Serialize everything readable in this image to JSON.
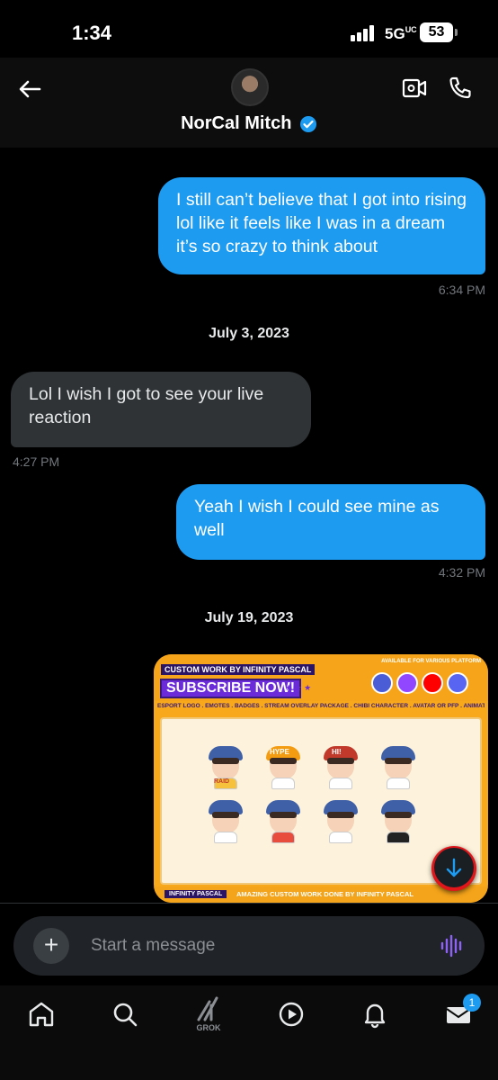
{
  "status_bar": {
    "time": "1:34",
    "network": "5G",
    "network_suffix": "UC",
    "battery": "53"
  },
  "header": {
    "contact_name": "NorCal Mitch",
    "verified": true,
    "icons": [
      "back-arrow-icon",
      "video-call-icon",
      "phone-call-icon",
      "verified-badge-icon"
    ]
  },
  "messages": [
    {
      "type": "out",
      "text": "I still can’t believe that I got into rising lol like it feels like I was in a dream it’s so crazy to think about",
      "time": "6:34 PM"
    },
    {
      "type": "date",
      "text": "July 3, 2023"
    },
    {
      "type": "in",
      "text": "Lol I wish I got to see your live reaction",
      "time": "4:27 PM"
    },
    {
      "type": "out",
      "text": "Yeah I wish I could see mine as well",
      "time": "4:32 PM"
    },
    {
      "type": "date",
      "text": "July 19, 2023"
    }
  ],
  "image_attachment": {
    "header_text": "CUSTOM WORK BY INFINITY PASCAL",
    "subscribe_text": "SUBSCRIBE NOW!",
    "stars": "★ ★ ★",
    "available_text": "AVAILABLE FOR VARIOUS PLATFORM",
    "services_text": "ESPORT LOGO . EMOTES . BADGES . STREAM OVERLAY PACKAGE . CHIBI CHARACTER . AVATAR OR PFP . ANIMATION STREAM GRAPHIC .",
    "emote_labels": [
      "RAID",
      "HYPE",
      "HI!"
    ],
    "footer_brand": "INFINITY PASCAL",
    "footer_text": "AMAZING CUSTOM WORK DONE BY INFINITY PASCAL"
  },
  "composer": {
    "placeholder": "Start a message"
  },
  "nav": {
    "grok_label": "GROK",
    "messages_badge": "1"
  },
  "colors": {
    "accent": "#1d9bf0",
    "incoming_bubble": "#2f3336",
    "background": "#000000",
    "voice_icon": "#8e62f7"
  }
}
